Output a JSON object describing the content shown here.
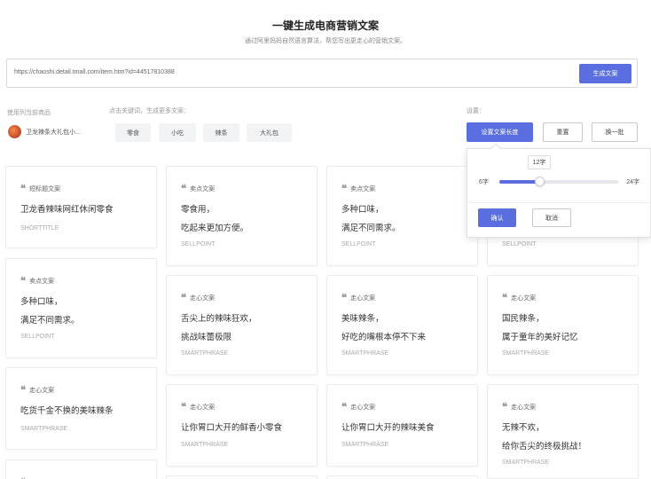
{
  "header": {
    "title": "一键生成电商营销文案",
    "subtitle": "通过阿里妈妈自然语言算法，帮您写出更走心的营销文案。"
  },
  "url_input": {
    "value": "https://chaoshi.detail.tmall.com/item.htm?id=44517810388",
    "button_label": "生成文案"
  },
  "product_section": {
    "label": "使用列当前商品",
    "product_name": "卫龙辣条大礼包小..."
  },
  "keywords_section": {
    "label": "点击关键词，生成更多文案：",
    "tags": [
      "零食",
      "小吃",
      "辣条",
      "大礼包"
    ]
  },
  "settings": {
    "label": "设置：",
    "length_button": "设置文案长度",
    "reset_button": "重置",
    "refresh_button": "换一批"
  },
  "length_popover": {
    "current_value_label": "12字",
    "min_label": "6字",
    "max_label": "24字",
    "min": 6,
    "max": 24,
    "value": 12,
    "confirm_label": "确认",
    "cancel_label": "取消"
  },
  "cards": [
    {
      "type": "短标题文案",
      "text": "卫龙香辣味网红休闲零食",
      "code": "SHORTTITLE"
    },
    {
      "type": "卖点文案",
      "text": "多种口味，\n满足不同需求。",
      "code": "SELLPOINT"
    },
    {
      "type": "走心文案",
      "text": "吃货千金不换的美味辣条",
      "code": "SMARTPHRASE"
    },
    {
      "type": "卖点文案",
      "text": "零食用，\n吃起来更加方便。",
      "code": "SELLPOINT"
    },
    {
      "type": "走心文案",
      "text": "舌尖上的辣味狂欢，\n挑战味蕾极限",
      "code": "SMARTPHRASE"
    },
    {
      "type": "走心文案",
      "text": "让你胃口大开的鲜香小零食",
      "code": "SMARTPHRASE"
    },
    {
      "type": "卖点文案",
      "text": "多种口味，\n满足不同需求。",
      "code": "SELLPOINT"
    },
    {
      "type": "走心文案",
      "text": "美味辣条，\n好吃的嘴根本停不下来",
      "code": "SMARTPHRASE"
    },
    {
      "type": "走心文案",
      "text": "让你胃口大开的辣味美食",
      "code": "SMARTPHRASE"
    },
    {
      "type": "",
      "text": "",
      "code": "SELLPOINT"
    },
    {
      "type": "走心文案",
      "text": "国民辣条，\n属于童年的美好记忆",
      "code": "SMARTPHRASE"
    },
    {
      "type": "走心文案",
      "text": "无辣不欢，\n给你舌尖的终极挑战！",
      "code": "SMARTPHRASE"
    },
    {
      "type": "走心文案",
      "text": "",
      "code": ""
    }
  ]
}
